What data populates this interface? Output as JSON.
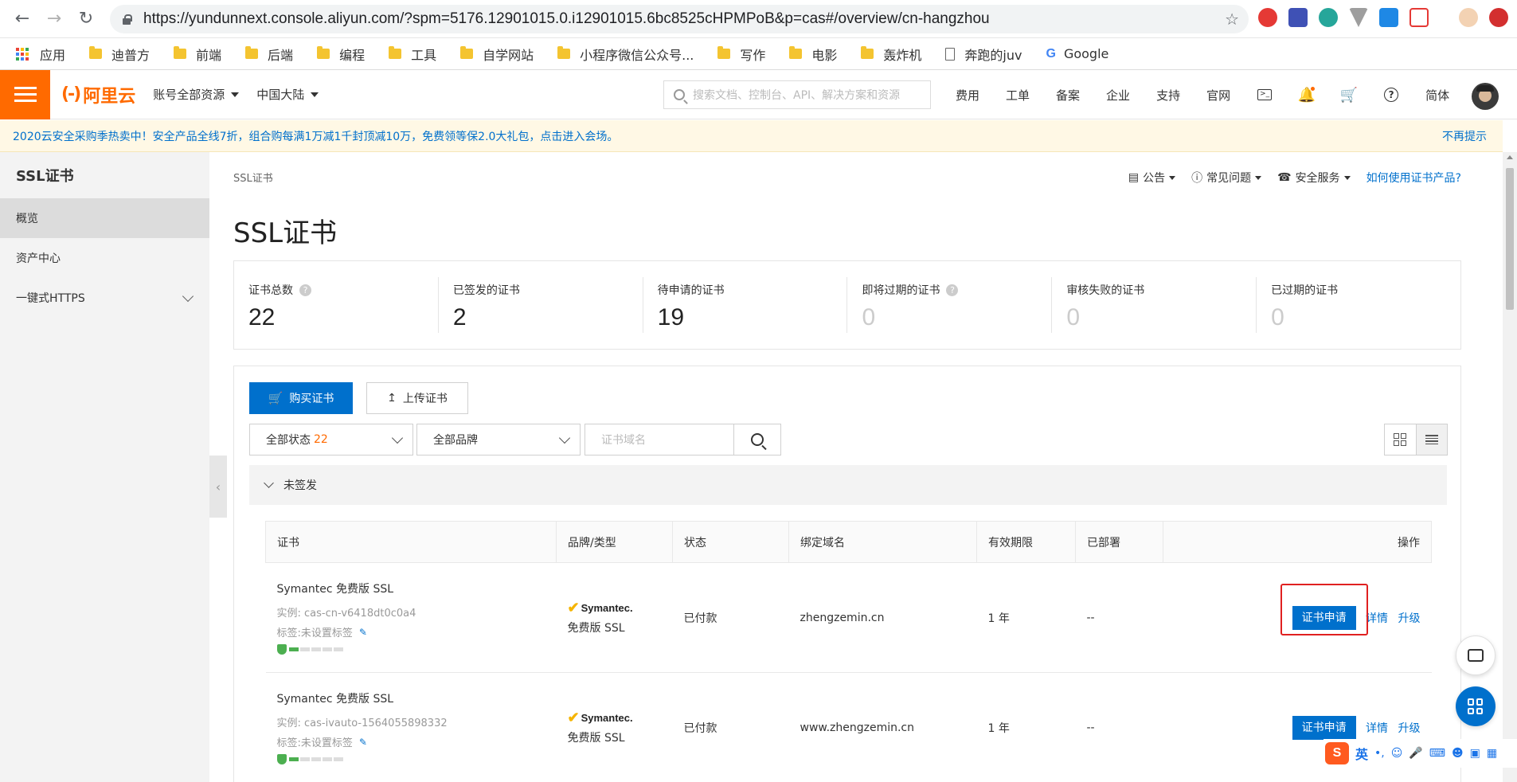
{
  "browser": {
    "url": "https://yundunnext.console.aliyun.com/?spm=5176.12901015.0.i12901015.6bc8525cHPMPoB&p=cas#/overview/cn-hangzhou",
    "bookmarks": [
      "应用",
      "迪普方",
      "前端",
      "后端",
      "编程",
      "工具",
      "自学网站",
      "小程序微信公众号...",
      "写作",
      "电影",
      "轰炸机",
      "奔跑的juv",
      "Google"
    ]
  },
  "header": {
    "logo": "阿里云",
    "account_dropdown": "账号全部资源",
    "region_dropdown": "中国大陆",
    "search_placeholder": "搜索文档、控制台、API、解决方案和资源",
    "links": [
      "费用",
      "工单",
      "备案",
      "企业",
      "支持",
      "官网"
    ],
    "language": "简体"
  },
  "notice": {
    "text": "2020云安全采购季热卖中！安全产品全线7折，组合购每满1万减1千封顶减10万，免费领等保2.0大礼包，点击进入会场。",
    "dismiss": "不再提示"
  },
  "sidebar": {
    "title": "SSL证书",
    "items": [
      {
        "label": "概览",
        "active": true
      },
      {
        "label": "资产中心",
        "active": false
      },
      {
        "label": "一键式HTTPS",
        "active": false
      }
    ]
  },
  "main": {
    "breadcrumb": "SSL证书",
    "title": "SSL证书",
    "top_links": {
      "announcement": "公告",
      "faq": "常见问题",
      "security_service": "安全服务",
      "how_to": "如何使用证书产品?"
    },
    "stats": [
      {
        "label": "证书总数",
        "value": "22",
        "help": true
      },
      {
        "label": "已签发的证书",
        "value": "2",
        "help": false
      },
      {
        "label": "待申请的证书",
        "value": "19",
        "help": false
      },
      {
        "label": "即将过期的证书",
        "value": "0",
        "help": true
      },
      {
        "label": "审核失败的证书",
        "value": "0",
        "help": false
      },
      {
        "label": "已过期的证书",
        "value": "0",
        "help": false
      }
    ],
    "buttons": {
      "buy": "购买证书",
      "upload": "上传证书"
    },
    "filters": {
      "status_label": "全部状态",
      "status_count": "22",
      "brand_label": "全部品牌",
      "domain_placeholder": "证书域名"
    },
    "group": "未签发",
    "table": {
      "headers": [
        "证书",
        "品牌/类型",
        "状态",
        "绑定域名",
        "有效期限",
        "已部署",
        "操作"
      ],
      "rows": [
        {
          "name": "Symantec 免费版 SSL",
          "instance": "实例: cas-cn-v6418dt0c0a4",
          "tag": "标签:未设置标签",
          "brand": "Symantec.",
          "brand_type": "免费版 SSL",
          "status": "已付款",
          "domain": "zhengzemin.cn",
          "validity": "1 年",
          "deployed": "--",
          "apply": "证书申请",
          "detail": "详情",
          "upgrade": "升级"
        },
        {
          "name": "Symantec 免费版 SSL",
          "instance": "实例: cas-ivauto-1564055898332",
          "tag": "标签:未设置标签",
          "brand": "Symantec.",
          "brand_type": "免费版 SSL",
          "status": "已付款",
          "domain": "www.zhengzemin.cn",
          "validity": "1 年",
          "deployed": "--",
          "apply": "证书申请",
          "detail": "详情",
          "upgrade": "升级"
        }
      ]
    }
  },
  "ime": {
    "lang": "英"
  },
  "colors": {
    "brand_orange": "#ff6a00",
    "primary_blue": "#0070cc",
    "highlight_red": "#e02020"
  }
}
